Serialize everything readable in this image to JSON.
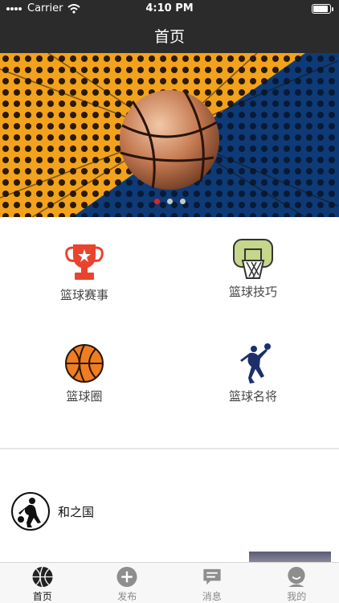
{
  "status_bar": {
    "carrier": "Carrier",
    "time": "4:10 PM"
  },
  "nav_bar": {
    "title": "首页"
  },
  "banner": {
    "page_count": 3,
    "active_page": 1
  },
  "menu": {
    "items": [
      {
        "label": "篮球赛事",
        "icon": "trophy-icon"
      },
      {
        "label": "篮球技巧",
        "icon": "basketball-hoop-icon"
      },
      {
        "label": "篮球圈",
        "icon": "basketball-icon"
      },
      {
        "label": "篮球名将",
        "icon": "basketball-player-icon"
      }
    ]
  },
  "feed": {
    "post": {
      "author": "和之国"
    }
  },
  "tab_bar": {
    "active": 0,
    "items": [
      {
        "label": "首页",
        "icon": "basketball-icon"
      },
      {
        "label": "发布",
        "icon": "plus-circle-icon"
      },
      {
        "label": "消息",
        "icon": "message-icon"
      },
      {
        "label": "我的",
        "icon": "user-icon"
      }
    ]
  },
  "colors": {
    "header": "#2b2b2b",
    "trophy": "#e9432e",
    "basketball": "#ef7d22",
    "player": "#1d2f6b",
    "dot_active": "#e02424"
  }
}
